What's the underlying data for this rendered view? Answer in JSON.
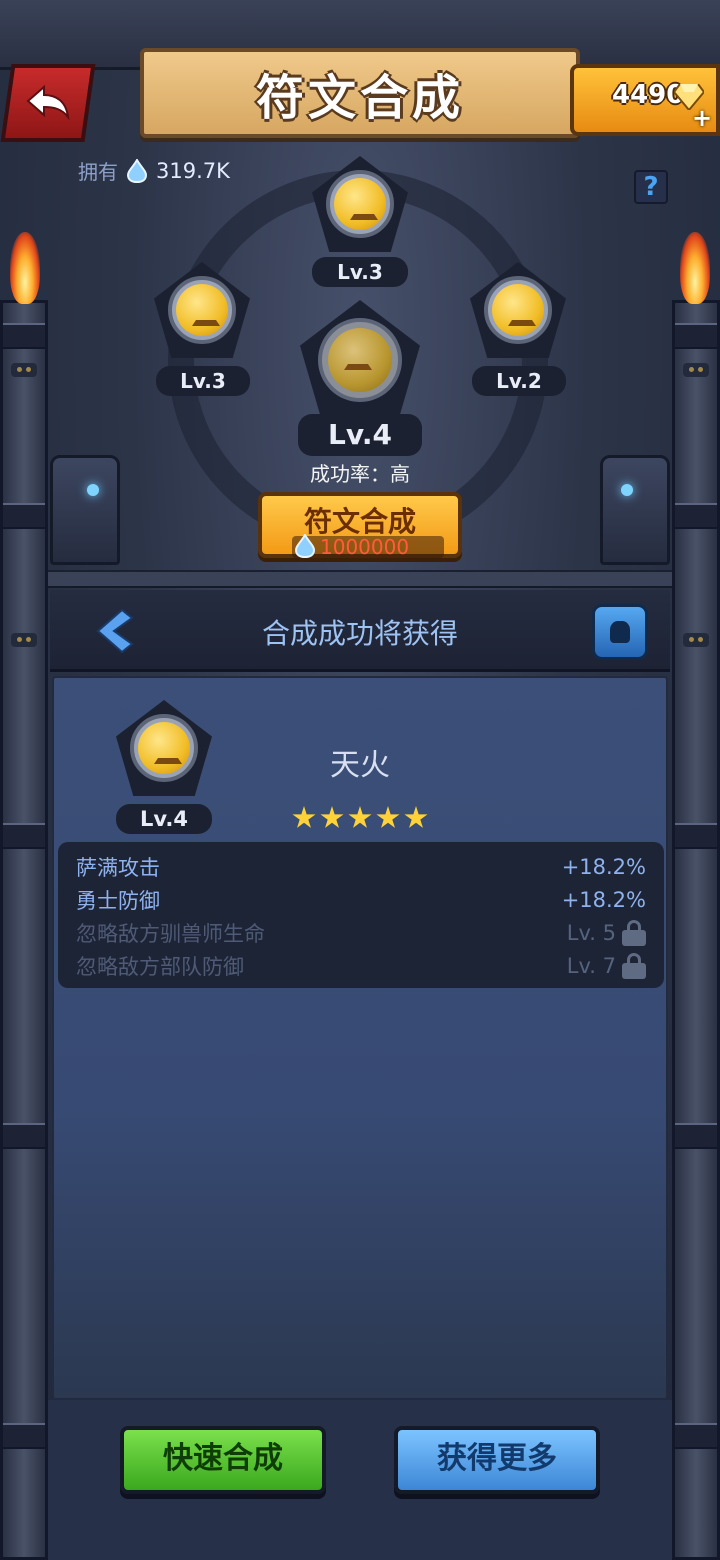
{
  "header": {
    "title": "符文合成",
    "gems": "4490",
    "gem_plus": "+",
    "help": "?"
  },
  "owned": {
    "label": "拥有",
    "value": "319.7K"
  },
  "slots": {
    "top": "Lv.3",
    "left": "Lv.3",
    "right": "Lv.2",
    "result": "Lv.4"
  },
  "success_rate": "成功率：高",
  "compose_button": {
    "label": "符文合成",
    "cost": "1000000"
  },
  "panel": {
    "title": "合成成功将获得",
    "reward": {
      "level": "Lv.4",
      "name": "天火",
      "stars": 5
    },
    "attributes": [
      {
        "name": "萨满攻击",
        "value": "+18.2%",
        "locked": false
      },
      {
        "name": "勇士防御",
        "value": "+18.2%",
        "locked": false
      },
      {
        "name": "忽略敌方驯兽师生命",
        "value": "Lv. 5",
        "locked": true
      },
      {
        "name": "忽略敌方部队防御",
        "value": "Lv. 7",
        "locked": true
      }
    ]
  },
  "buttons": {
    "quick": "快速合成",
    "more": "获得更多"
  },
  "colors": {
    "accent_gold": "#f39a16",
    "primary_green": "#3aa81e",
    "primary_blue": "#3d86d6",
    "cost_red": "#ff5b3d"
  }
}
